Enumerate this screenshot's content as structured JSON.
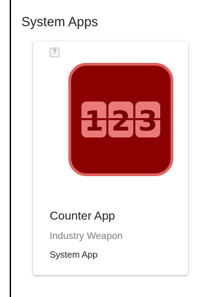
{
  "section": {
    "title": "System Apps"
  },
  "apps": [
    {
      "name": "Counter App",
      "vendor": "Industry Weapon",
      "type": "System App",
      "icon": "counter-123-icon",
      "badge_icon": "question-mark-icon",
      "badge_text": "?",
      "icon_digits": [
        "1",
        "2",
        "3"
      ],
      "colors": {
        "icon_background": "#8b0000",
        "icon_border": "#e06060",
        "digit_tile": "#e87a7a",
        "digit_text": "#7a0000"
      }
    }
  ]
}
